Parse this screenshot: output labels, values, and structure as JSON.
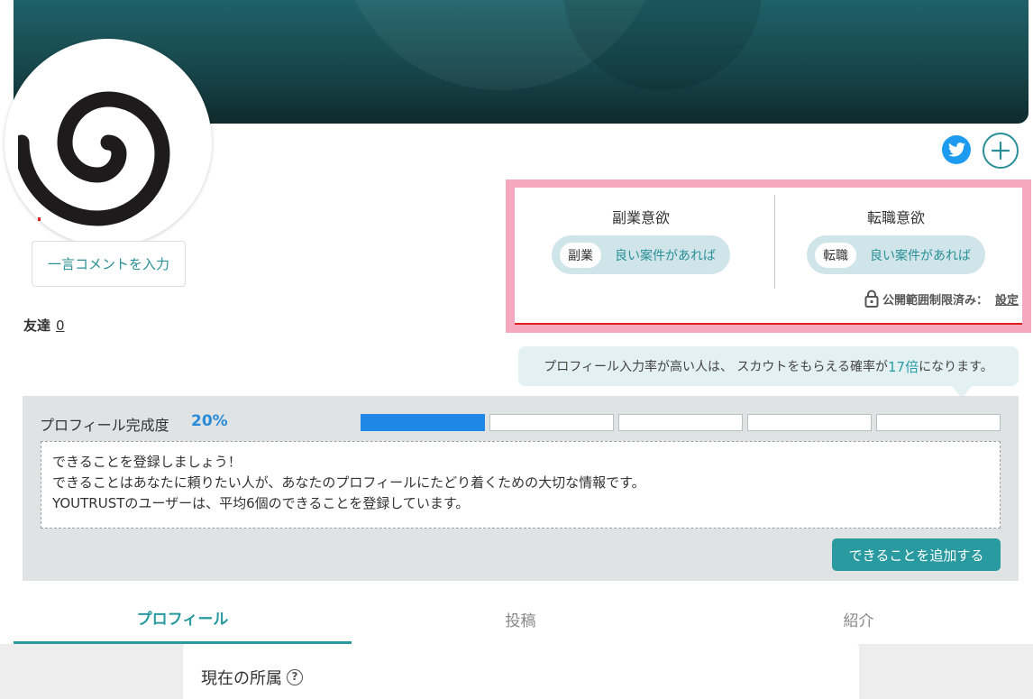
{
  "profile": {
    "comment_placeholder": "一言コメントを入力",
    "friends_label": "友達",
    "friends_count": "0"
  },
  "social": {
    "twitter_icon": "twitter-bird-icon",
    "add_icon": "plus-icon"
  },
  "intent": {
    "side_job": {
      "title": "副業意欲",
      "tag": "副業",
      "value": "良い案件があれば"
    },
    "job_change": {
      "title": "転職意欲",
      "tag": "転職",
      "value": "良い案件があれば"
    },
    "privacy_label": "公開範囲制限済み：",
    "privacy_link": "設定"
  },
  "tooltip": {
    "prefix": "プロフィール入力率が高い人は、 スカウトをもらえる確率が",
    "highlight": "17倍",
    "suffix": "になります。"
  },
  "completion": {
    "label": "プロフィール完成度",
    "percent_text": "20%",
    "progress": 0.2,
    "tip_lines": [
      "できることを登録しましょう！",
      "できることはあなたに頼りたい人が、あなたのプロフィールにたどり着くための大切な情報です。",
      "YOUTRUSTのユーザーは、平均6個のできることを登録しています。"
    ],
    "add_button": "できることを追加する"
  },
  "tabs": [
    {
      "label": "プロフィール",
      "active": true
    },
    {
      "label": "投稿",
      "active": false
    },
    {
      "label": "紹介",
      "active": false
    }
  ],
  "section": {
    "title": "現在の所属",
    "help": "?"
  },
  "colors": {
    "accent": "#2a9aa1",
    "progress": "#1f87e5",
    "highlight_frame": "#f8a7c0"
  }
}
